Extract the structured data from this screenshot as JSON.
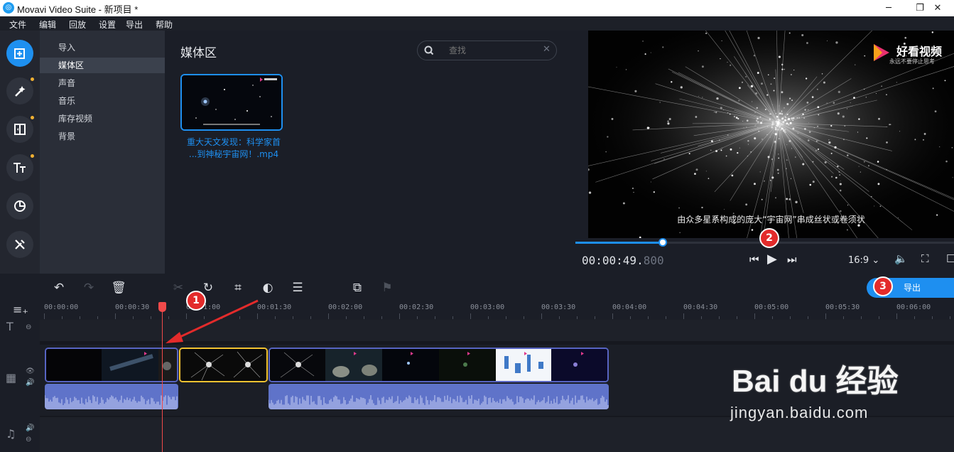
{
  "window": {
    "title": "Movavi Video Suite - 新项目 *",
    "minimize": "─",
    "maximize": "❐",
    "close": "✕"
  },
  "menu": [
    "文件",
    "编辑",
    "回放",
    "设置",
    "导出",
    "帮助"
  ],
  "rail": {
    "icons": [
      "import-icon",
      "magic-wand-icon",
      "transition-icon",
      "titles-icon",
      "stickers-icon",
      "tools-icon"
    ],
    "accent": "#1e90f0"
  },
  "categories": [
    "导入",
    "媒体区",
    "声音",
    "音乐",
    "库存视频",
    "背景"
  ],
  "media": {
    "title": "媒体区",
    "search_placeholder": "查找",
    "items": [
      {
        "name_line1": "重大天文发现：科学家首",
        "name_line2": "...到神秘宇宙网！.mp4"
      }
    ]
  },
  "preview": {
    "subtitle": "由众多星系构成的庞大“宇宙网”串成丝状或卷须状",
    "brand_name": "好看视频",
    "brand_sub": "永远不要停止思考",
    "time_main": "00:00:49.",
    "time_ms": "800",
    "progress": 0.23,
    "aspect": "16:9 ⌄"
  },
  "toolbar": {
    "export_label": "导出"
  },
  "ruler": {
    "labels": [
      "00:00:00",
      "00:00:30",
      "00:01:00",
      "00:01:30",
      "00:02:00",
      "00:02:30",
      "00:03:00",
      "00:03:30",
      "00:04:00",
      "00:04:30",
      "00:05:00",
      "00:05:30",
      "00:06:00"
    ]
  },
  "annotations": {
    "badge1": "1",
    "badge2": "2",
    "badge3": "3"
  },
  "watermark": {
    "logo": "Bai du 经验",
    "url": "jingyan.baidu.com"
  },
  "colors": {
    "accent": "#1e8ff0",
    "playhead": "#f14a4a",
    "selected_clip": "#f2c331",
    "audio": "#5f73c9"
  }
}
